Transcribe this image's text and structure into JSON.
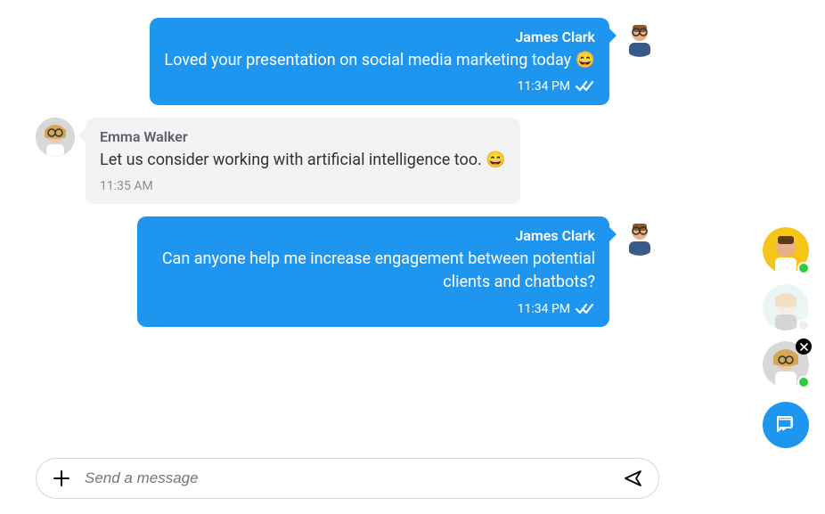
{
  "messages": [
    {
      "sender": "James Clark",
      "text": "Loved your presentation on social media marketing today 😄",
      "time": "11:34 PM",
      "direction": "outgoing",
      "read": true
    },
    {
      "sender": "Emma Walker",
      "text": "Let us consider working with artificial intelligence too. 😄",
      "time": "11:35 AM",
      "direction": "incoming",
      "read": false
    },
    {
      "sender": "James Clark",
      "text": "Can anyone help me increase engagement between potential clients and chatbots?",
      "time": "11:34 PM",
      "direction": "outgoing",
      "read": true
    }
  ],
  "input": {
    "placeholder": "Send a message"
  },
  "contacts": [
    {
      "name": "contact-1",
      "status": "online",
      "faded": false,
      "close": false
    },
    {
      "name": "contact-2",
      "status": "offline",
      "faded": true,
      "close": false
    },
    {
      "name": "contact-3",
      "status": "online",
      "faded": false,
      "close": true
    }
  ]
}
